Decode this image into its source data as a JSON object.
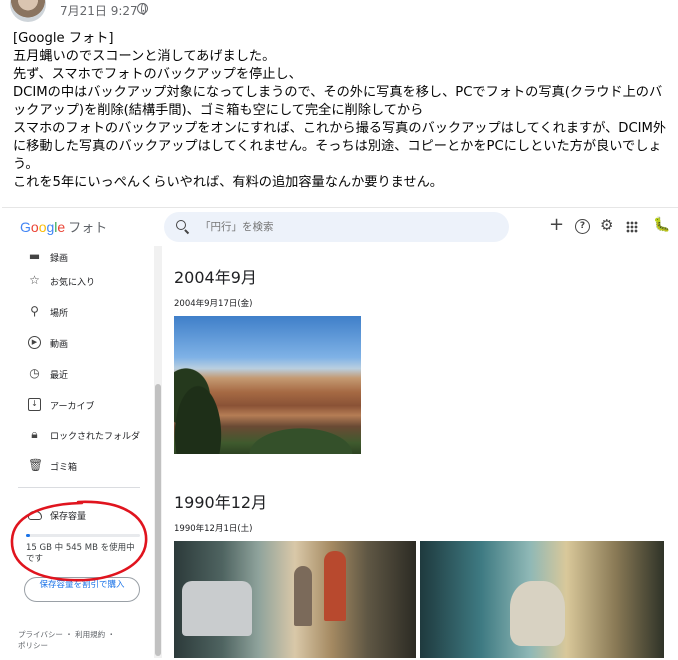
{
  "post": {
    "time": "7月21日 9:27 ·",
    "lines": [
      "[Google フォト]",
      "五月蝿いのでスコーンと消してあげました。",
      "先ず、スマホでフォトのバックアップを停止し、",
      "DCIMの中はバックアップ対象になってしまうので、その外に写真を移し、PCでフォトの写真(クラウド上のバックアップ)を削除(結構手間)、ゴミ箱も空にして完全に削除してから",
      "スマホのフォトのバックアップをオンにすれば、これから撮る写真のバックアップはしてくれますが、DCIM外に移動した写真のバックアップはしてくれません。そっちは別途、コピーとかをPCにしといた方が良いでしょう。",
      "これを5年にいっぺんくらいやれば、有料の追加容量なんか要りません。"
    ]
  },
  "photos_app": {
    "logo_google": [
      "G",
      "o",
      "o",
      "g",
      "l",
      "e"
    ],
    "logo_suffix": "フォト",
    "search_placeholder": "「円行」を検索",
    "icons": {
      "add": "plus-icon",
      "help": "help-icon",
      "settings": "gear-icon",
      "apps": "apps-grid-icon",
      "account": "bug-avatar-icon"
    },
    "help_glyph": "?",
    "sidebar": {
      "items": [
        {
          "label": "録画",
          "icon": "video-icon"
        },
        {
          "label": "お気に入り",
          "icon": "star-icon"
        },
        {
          "label": "場所",
          "icon": "location-icon"
        },
        {
          "label": "動画",
          "icon": "play-icon"
        },
        {
          "label": "最近",
          "icon": "clock-icon"
        },
        {
          "label": "アーカイブ",
          "icon": "archive-icon"
        },
        {
          "label": "ロックされたフォルダ",
          "icon": "lock-icon"
        },
        {
          "label": "ゴミ箱",
          "icon": "trash-icon"
        }
      ],
      "storage_title": "保存容量",
      "storage_usage": "15 GB 中 545 MB を使用中です",
      "storage_used_fraction": 0.036,
      "buy_button": "保存容量を割引で購入",
      "footer": "プライバシー ・ 利用規約 ・\nポリシー"
    },
    "sections": [
      {
        "year": "2004年9月",
        "date": "2004年9月17日(金)"
      },
      {
        "year": "1990年12月",
        "date": "1990年12月1日(土)"
      }
    ],
    "colors": {
      "google_blue": "#4285f4",
      "google_red": "#ea4335",
      "google_yellow": "#fbbc05",
      "google_green": "#34a853",
      "accent": "#1a73e8",
      "annotation": "#e0141e"
    }
  }
}
